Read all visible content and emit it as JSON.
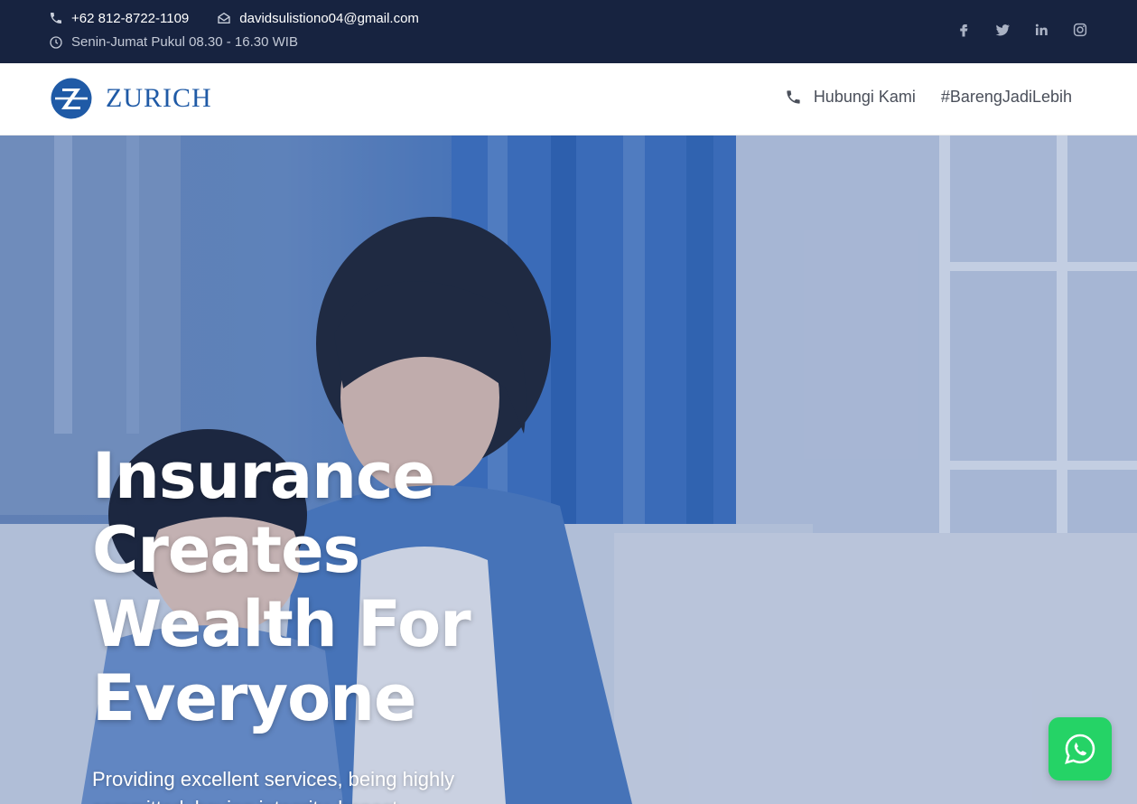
{
  "topbar": {
    "phone": "+62 812-8722-1109",
    "email": "davidsulistiono04@gmail.com",
    "hours": "Senin-Jumat Pukul 08.30 - 16.30 WIB",
    "socials": [
      "facebook-icon",
      "twitter-icon",
      "linkedin-icon",
      "instagram-icon"
    ],
    "bg_color": "#172340"
  },
  "navbar": {
    "logo_text": "ZURICH",
    "logo_letter": "Z",
    "links": {
      "contact": "Hubungi Kami",
      "tag": "#BarengJadiLebih"
    },
    "brand_color": "#1f5aa6"
  },
  "hero": {
    "title_lines": [
      "Insurance",
      "Creates",
      "Wealth For",
      "Everyone"
    ],
    "subtitle_lines": [
      "Providing excellent services, being highly",
      "committed, having integrity, honest, ..."
    ]
  },
  "whatsapp": {
    "icon": "whatsapp-icon",
    "color": "#25d366"
  }
}
